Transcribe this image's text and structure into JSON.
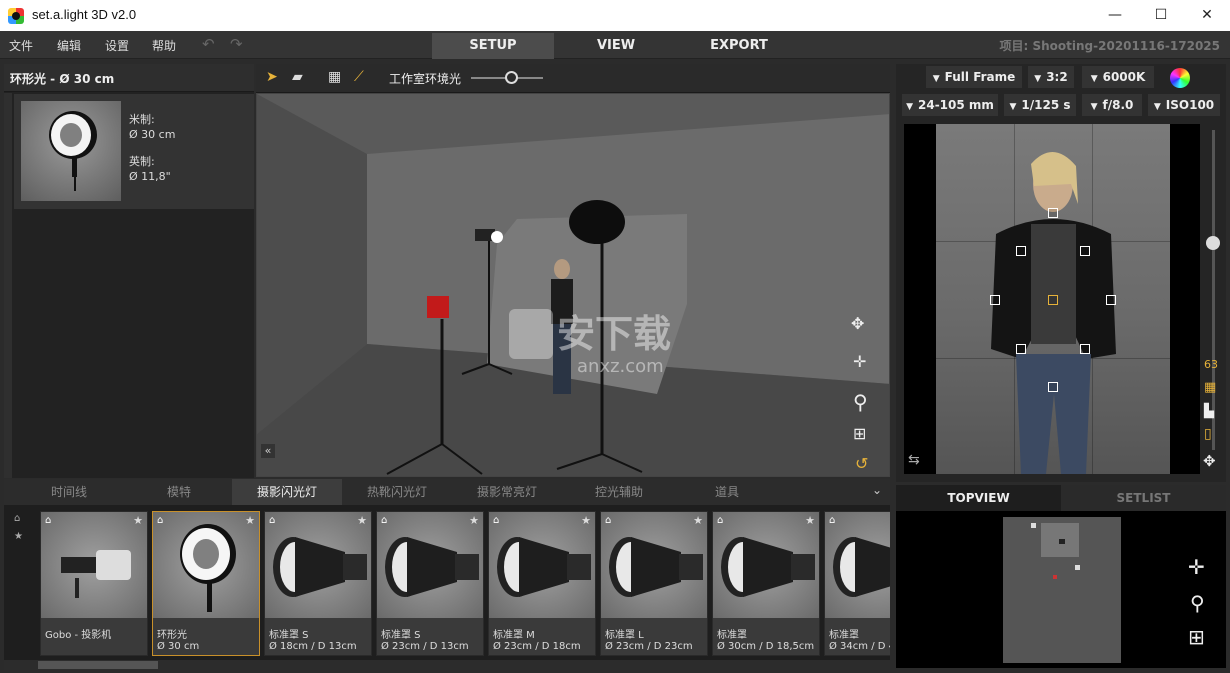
{
  "window": {
    "title": "set.a.light 3D v2.0",
    "minimize": "—",
    "maximize": "☐",
    "close": "✕"
  },
  "menu": {
    "file": "文件",
    "edit": "编辑",
    "settings": "设置",
    "help": "帮助",
    "undo": "↶",
    "redo": "↷"
  },
  "nav": {
    "setup": "SETUP",
    "view": "VIEW",
    "export": "EXPORT"
  },
  "project": "项目: Shooting-20201116-172025",
  "light_info": {
    "header": "环形光 - Ø 30 cm",
    "metric_label": "米制:",
    "metric_value": "Ø 30 cm",
    "imperial_label": "英制:",
    "imperial_value": "Ø 11,8\""
  },
  "viewport_toolbar": {
    "ambient_label": "工作室环境光",
    "ambient_level": 0.55
  },
  "camera": {
    "sensor": "Full Frame",
    "ratio": "3:2",
    "wb": "6000K",
    "lens": "24-105 mm",
    "shutter": "1/125 s",
    "aperture": "f/8.0",
    "iso": "ISO100",
    "zoom": "63"
  },
  "library_tabs": [
    "时间线",
    "模特",
    "摄影闪光灯",
    "热靴闪光灯",
    "摄影常亮灯",
    "控光辅助",
    "道具"
  ],
  "library_items": [
    {
      "name": "Gobo - 投影机",
      "size": ""
    },
    {
      "name": "环形光",
      "size": "Ø 30 cm"
    },
    {
      "name": "标准罩 S",
      "size": "Ø 18cm / D 13cm"
    },
    {
      "name": "标准罩 S",
      "size": "Ø 23cm / D 13cm"
    },
    {
      "name": "标准罩 M",
      "size": "Ø 23cm / D 18cm"
    },
    {
      "name": "标准罩 L",
      "size": "Ø 23cm / D 23cm"
    },
    {
      "name": "标准罩",
      "size": "Ø 30cm / D 18,5cm"
    },
    {
      "name": "标准罩",
      "size": "Ø 34cm / D 4"
    }
  ],
  "right_tabs": {
    "topview": "TOPVIEW",
    "setlist": "SETLIST"
  },
  "watermark": {
    "cn": "安下载",
    "en": "anxz.com"
  },
  "colors": {
    "accent": "#e6b23a",
    "selected_border": "#c8902a"
  }
}
